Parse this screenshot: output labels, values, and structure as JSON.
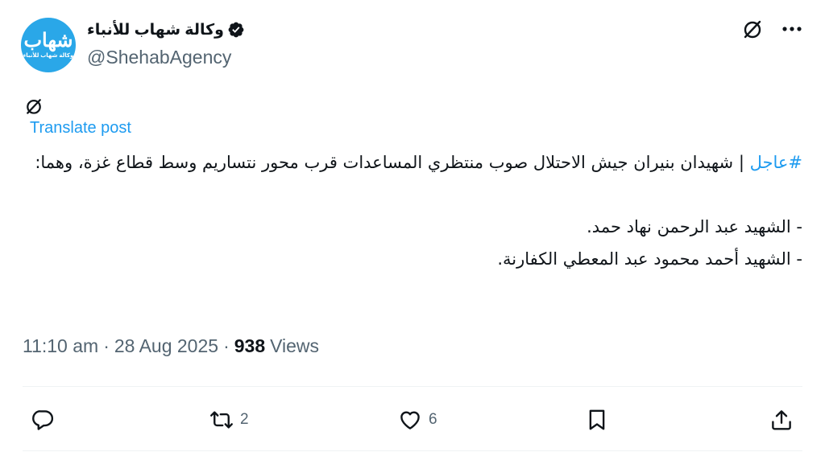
{
  "author": {
    "display_name": "وكالة شهاب للأنباء",
    "handle": "@ShehabAgency",
    "avatar_logo": "شهاب",
    "avatar_subtitle": "وكالة شهاب للأنباء",
    "verified": true
  },
  "icons": {
    "grok": "grok-icon",
    "more": "more-icon",
    "reply": "reply-icon",
    "repost": "repost-icon",
    "like": "like-icon",
    "bookmark": "bookmark-icon",
    "share": "share-icon"
  },
  "translate_label": "Translate post",
  "post": {
    "hashtag": "#عاجل",
    "line1_rest": " | شهيدان بنيران جيش الاحتلال صوب منتظري المساعدات قرب محور نتساريم وسط قطاع غزة، وهما:",
    "line2": "- الشهيد عبد الرحمن نهاد حمد.",
    "line3": "- الشهيد أحمد محمود عبد المعطي الكفارنة."
  },
  "meta": {
    "time": "11:10 am",
    "sep1": "·",
    "date": "28 Aug 2025",
    "sep2": "·",
    "views_count": "938",
    "views_label": "Views"
  },
  "stats": {
    "replies": "",
    "reposts": "2",
    "likes": "6"
  },
  "colors": {
    "accent": "#1d9bf0",
    "text": "#0f1419",
    "muted": "#536471",
    "avatar_bg": "#2aa7e8"
  }
}
